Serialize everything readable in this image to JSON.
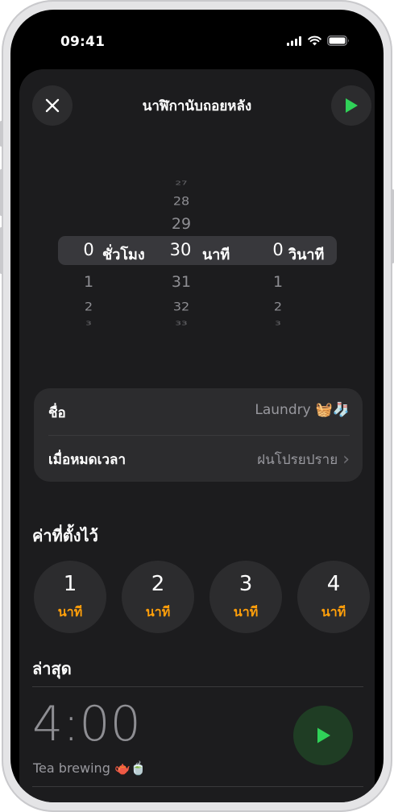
{
  "status_bar": {
    "time": "09:41"
  },
  "nav": {
    "title": "นาฬิกานับถอยหลัง"
  },
  "picker": {
    "hours": {
      "above": [],
      "selected": "0",
      "below": [
        "1",
        "2",
        "3"
      ],
      "label": "ชั่วโมง"
    },
    "minutes": {
      "above": [
        "27",
        "28",
        "29"
      ],
      "selected": "30",
      "below": [
        "31",
        "32",
        "33"
      ],
      "label": "นาที"
    },
    "seconds": {
      "above": [],
      "selected": "0",
      "below": [
        "1",
        "2",
        "3"
      ],
      "label": "วินาที"
    }
  },
  "settings": {
    "name_label": "ชื่อ",
    "name_value": "Laundry",
    "name_emoji": "🧺🧦",
    "when_done_label": "เมื่อหมดเวลา",
    "when_done_value": "ฝนโปรยปราย",
    "chevron": "›"
  },
  "presets": {
    "title": "ค่าที่ตั้งไว้",
    "items": [
      {
        "value": "1",
        "unit": "นาที"
      },
      {
        "value": "2",
        "unit": "นาที"
      },
      {
        "value": "3",
        "unit": "นาที"
      },
      {
        "value": "4",
        "unit": "นาที"
      }
    ]
  },
  "recents": {
    "title": "ล่าสุด",
    "items": [
      {
        "time": "4:00",
        "label": "Tea brewing",
        "emoji": "🫖🍵"
      }
    ]
  },
  "colors": {
    "accent_orange": "#ff9f0a",
    "start_green": "#30d158",
    "sheet_bg": "#1c1c1e",
    "control_bg": "#2c2c2e"
  },
  "icons": {
    "close": "close-icon",
    "start": "play-icon",
    "signal": "cellular-signal-icon",
    "wifi": "wifi-icon",
    "battery": "battery-icon"
  }
}
